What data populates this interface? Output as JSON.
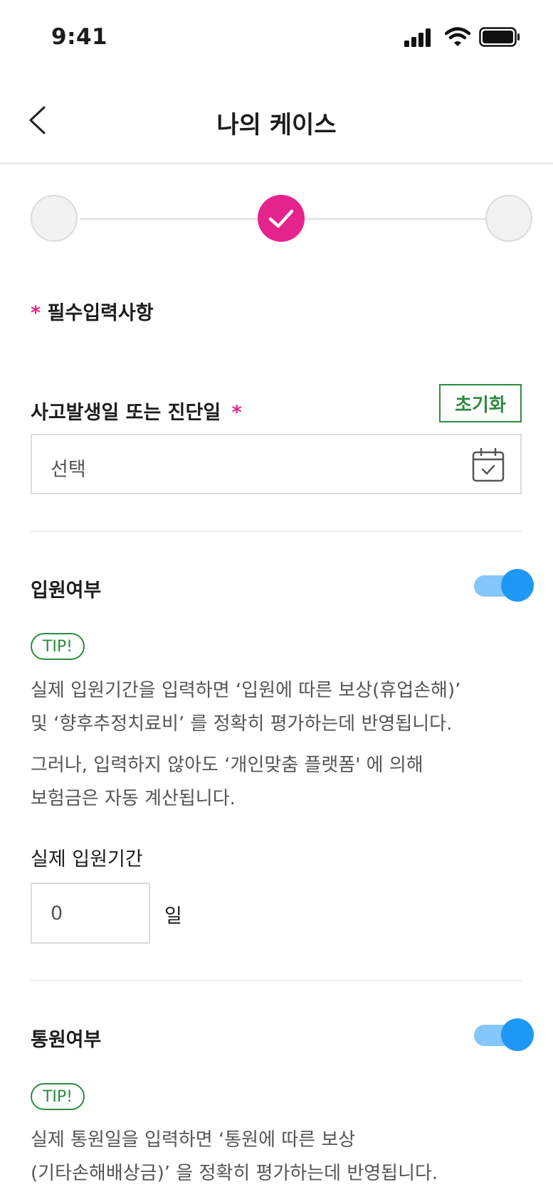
{
  "status_bar": {
    "time": "9:41"
  },
  "header": {
    "title": "나의 케이스"
  },
  "form": {
    "required_star": "*",
    "required_note": "필수입력사항",
    "accident_date": {
      "label": "사고발생일 또는 진단일",
      "star": "*",
      "reset_label": "초기화",
      "placeholder": "선택"
    },
    "hospitalization": {
      "label": "입원여부",
      "enabled": true,
      "tip_badge": "TIP!",
      "tip_line1": "실제 입원기간을 입력하면 ‘입원에 따른 보상(휴업손해)’",
      "tip_line2": "및 ‘향후추정치료비’ 를 정확히 평가하는데 반영됩니다.",
      "tip_line3": "그러나, 입력하지 않아도 ‘개인맞춤 플랫폼' 에 의해",
      "tip_line4": "보험금은 자동 계산됩니다.",
      "period_label": "실제 입원기간",
      "period_value": "0",
      "period_unit": "일"
    },
    "outpatient": {
      "label": "통원여부",
      "enabled": true,
      "tip_badge": "TIP!",
      "tip_line1": "실제 통원일을 입력하면 ‘통원에 따른 보상",
      "tip_line2": "(기타손해배상금)’ 을 정확히 평가하는데 반영됩니다."
    }
  },
  "colors": {
    "accent": "#e5238d",
    "green": "#2e8b3e",
    "toggle": "#1e98f5"
  }
}
